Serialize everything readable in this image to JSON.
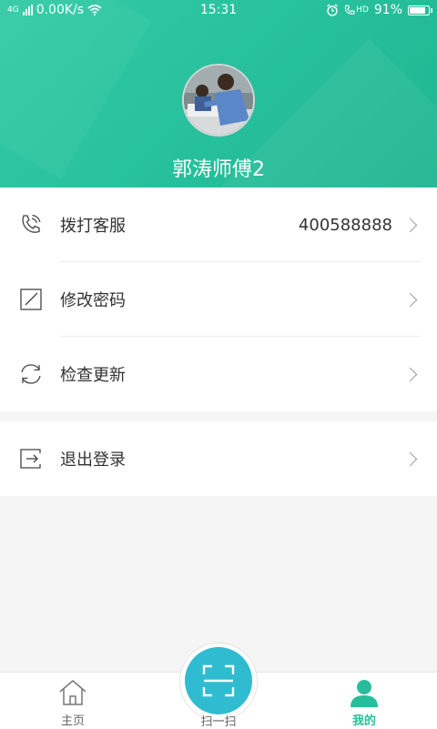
{
  "status_bar": {
    "network": "4G",
    "speed": "0.00K/s",
    "time": "15:31",
    "hd": "HD",
    "battery": "91%",
    "battery_level": 0.91
  },
  "profile": {
    "name": "郭涛师傅2"
  },
  "menu": {
    "items": [
      {
        "label": "拨打客服",
        "value": "400588888",
        "icon": "phone-icon"
      },
      {
        "label": "修改密码",
        "icon": "edit-icon"
      },
      {
        "label": "检查更新",
        "icon": "refresh-icon"
      }
    ],
    "logout": {
      "label": "退出登录",
      "icon": "logout-icon"
    }
  },
  "tabbar": {
    "home": {
      "label": "主页",
      "icon": "home-icon"
    },
    "scan": {
      "label": "扫一扫",
      "icon": "scan-icon"
    },
    "mine": {
      "label": "我的",
      "icon": "user-icon"
    }
  },
  "colors": {
    "accent": "#27bf9b",
    "scan": "#2fbcd0"
  }
}
